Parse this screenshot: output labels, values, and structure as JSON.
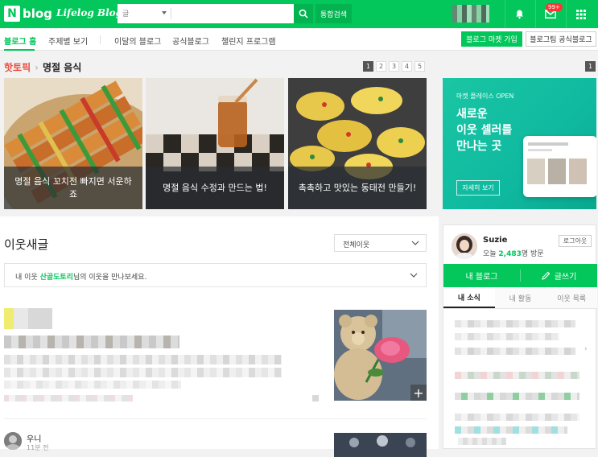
{
  "header": {
    "logo_n": "N",
    "logo_text": "blog",
    "lifelog": "Lifelog Blog",
    "search_scope": "글",
    "integrated_search": "통합검색",
    "mail_badge": "99+"
  },
  "subnav": {
    "items": [
      "블로그 홈",
      "주제별 보기",
      "이달의 블로그",
      "공식블로그",
      "챌린지 프로그램"
    ],
    "market_join": "블로그 마켓 가입",
    "official_blog": "블로그팀 공식블로그"
  },
  "hot_topic": {
    "label": "핫토픽",
    "category": "명절 음식",
    "pages": [
      "1",
      "2",
      "3",
      "4",
      "5"
    ],
    "active_page": "1",
    "cards": [
      {
        "caption": "명절 음식 꼬치전 빠지면 서운하죠"
      },
      {
        "caption": "명절 음식 수정과 만드는 법!"
      },
      {
        "caption": "촉촉하고 맛있는 동태전 만들기!"
      }
    ]
  },
  "banner": {
    "page": "1",
    "small": "마켓 플레이스 OPEN",
    "title_lines": [
      "새로운",
      "이웃 셀러를",
      "만나는 곳"
    ],
    "button": "자세히 보기"
  },
  "feed": {
    "title": "이웃새글",
    "filter": "전체이웃",
    "neighbor_prefix": "내 이웃 ",
    "neighbor_name": "산골도토리",
    "neighbor_suffix": "님의 이웃을 만나보세요.",
    "thumb_plus": "+",
    "post2_name": "우니",
    "post2_time": "11분 전"
  },
  "profile": {
    "name": "Suzie",
    "visit_prefix": "오늘 ",
    "visit_count": "2,483",
    "visit_suffix": "명 방문",
    "logout": "로그아웃",
    "my_blog": "내 블로그",
    "write": "글쓰기",
    "tabs": [
      "내 소식",
      "내 활동",
      "이웃 목록"
    ]
  },
  "colors": {
    "brand": "#03c75a",
    "hot": "#e84b3a"
  }
}
